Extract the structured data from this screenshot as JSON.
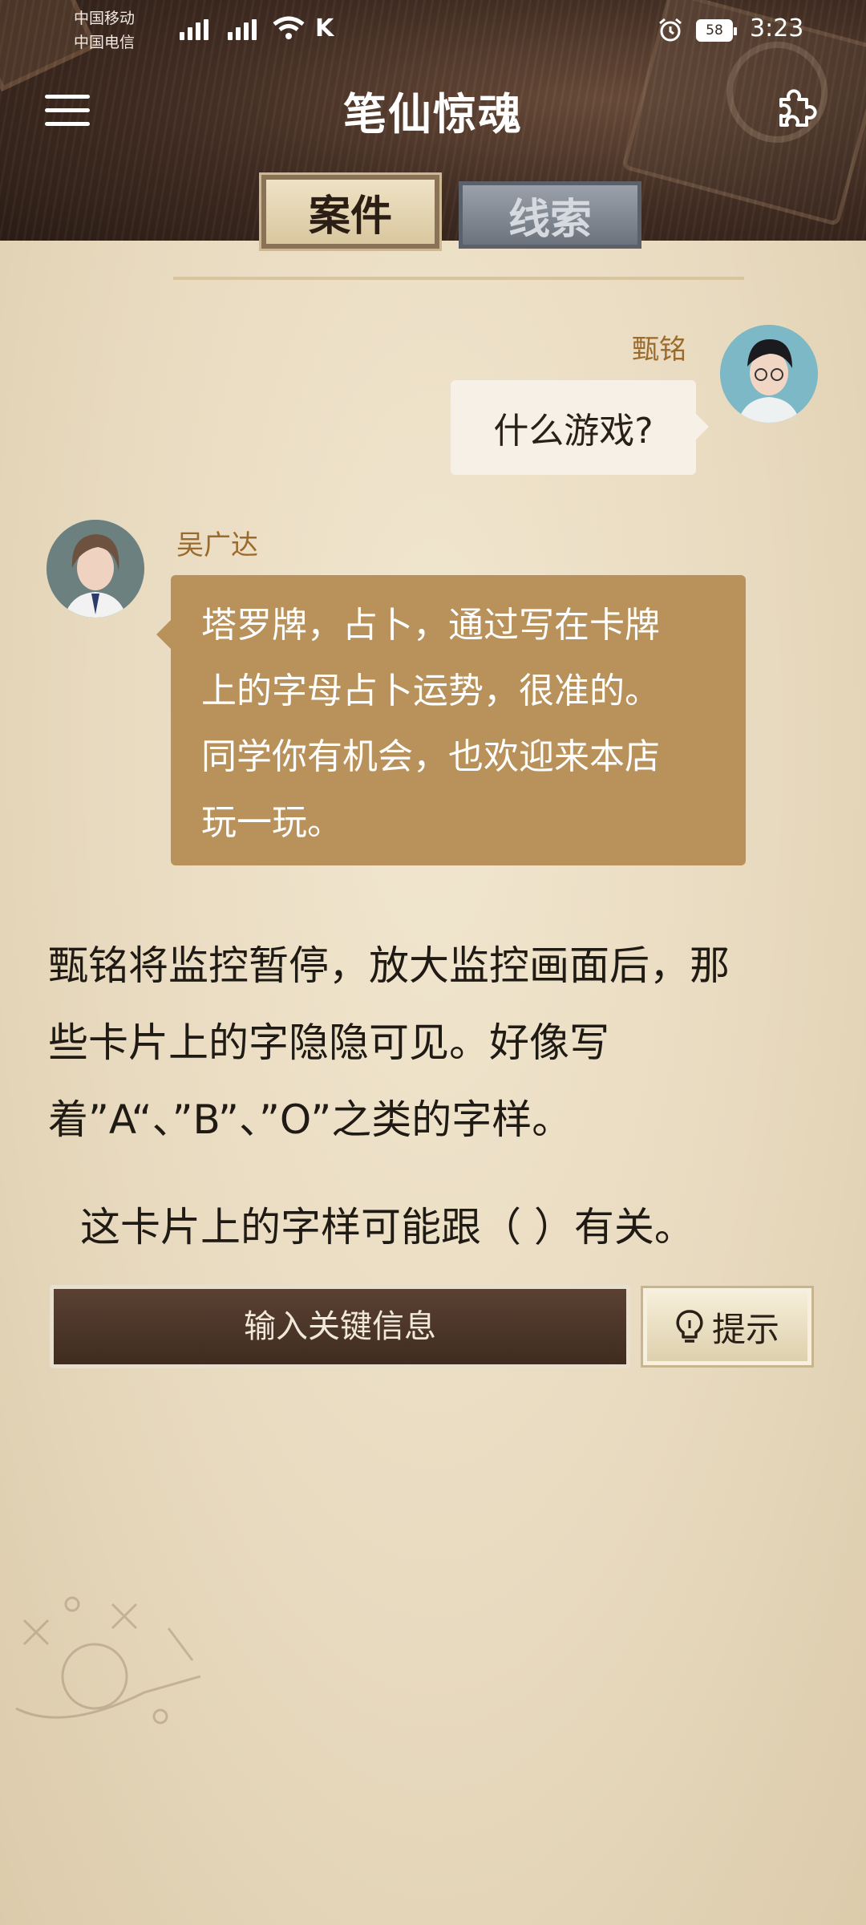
{
  "status_bar": {
    "carrier1": "中国移动",
    "carrier2": "中国电信",
    "battery": "58",
    "time": "3:23"
  },
  "header": {
    "title": "笔仙惊魂",
    "icons": {
      "menu": "hamburger-menu-icon",
      "puzzle": "puzzle-piece-icon"
    }
  },
  "tabs": [
    {
      "label": "案件",
      "active": true
    },
    {
      "label": "线索",
      "active": false
    }
  ],
  "chat": [
    {
      "speaker": "甄铭",
      "text": "什么游戏?",
      "side": "right"
    },
    {
      "speaker": "吴广达",
      "lines": [
        "塔罗牌，占卜，通过写在卡牌",
        "上的字母占卜运势，很准的。",
        "同学你有机会，也欢迎来本店",
        "玩一玩。"
      ],
      "side": "left"
    }
  ],
  "narration": {
    "lines": [
      "甄铭将监控暂停，放大监控画面后，那",
      "些卡片上的字隐隐可见。好像写",
      "着”A“、”B”、”O”之类的字样。"
    ]
  },
  "question": "这卡片上的字样可能跟（    ）有关。",
  "answer": {
    "placeholder": "输入关键信息",
    "value": ""
  },
  "hint_button": {
    "label": "提示",
    "icon": "lightbulb-icon"
  },
  "colors": {
    "accent_bubble": "#b8925a",
    "name_color": "#9a6b2c",
    "paper": "#e9dcc3"
  }
}
